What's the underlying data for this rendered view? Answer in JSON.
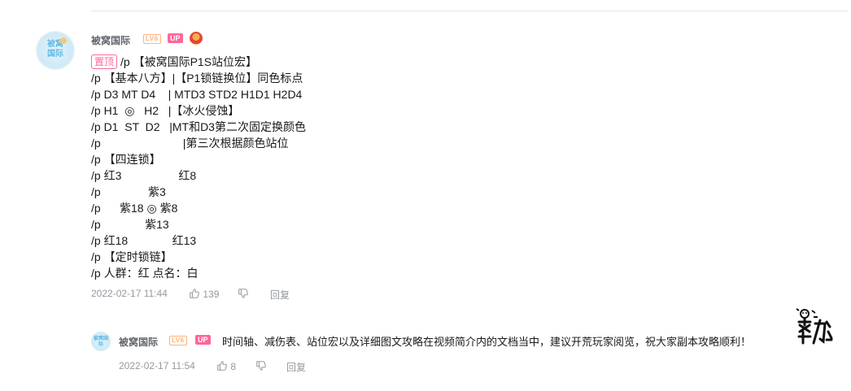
{
  "comment": {
    "username": "被窝国际",
    "level_badge": "LV6",
    "up_badge": "UP",
    "avatar_text": "被窝\n国际",
    "pin_tag": "置顶",
    "lines": [
      "/p 【被窝国际P1S站位宏】",
      "/p 【基本八方】|【P1锁链换位】同色标点",
      "/p D3 MT D4    | MTD3 STD2 H1D1 H2D4",
      "/p H1  ◎   H2   |【冰火侵蚀】",
      "/p D1  ST  D2   |MT和D3第二次固定换颜色",
      "/p                          |第三次根据颜色站位",
      "/p 【四连锁】",
      "/p 红3                  红8",
      "/p               紫3",
      "/p      紫18 ◎ 紫8",
      "/p              紫13",
      "/p 红18              红13",
      "/p 【定时锁链】",
      "/p 人群：红 点名：白"
    ],
    "timestamp": "2022-02-17 11:44",
    "like_count": "139",
    "reply_label": "回复"
  },
  "reply": {
    "username": "被窝国际",
    "level_badge": "LV6",
    "up_badge": "UP",
    "avatar_text": "被窝国际",
    "text": "时间轴、减伤表、站位宏以及详细图文攻略在视频简介内的文档当中，建议开荒玩家阅览，祝大家副本攻略顺利！",
    "timestamp": "2022-02-17 11:54",
    "like_count": "8",
    "reply_label": "回复"
  },
  "icons": {
    "like": "thumb-up-icon",
    "dislike": "thumb-down-icon",
    "medal": "fan-medal-icon",
    "sticker": "cheer-sticker-icon"
  },
  "colors": {
    "up_badge": "#ff6699",
    "level_badge": "#ffb27a",
    "meta_text": "#9499a0",
    "username": "#61666d"
  }
}
